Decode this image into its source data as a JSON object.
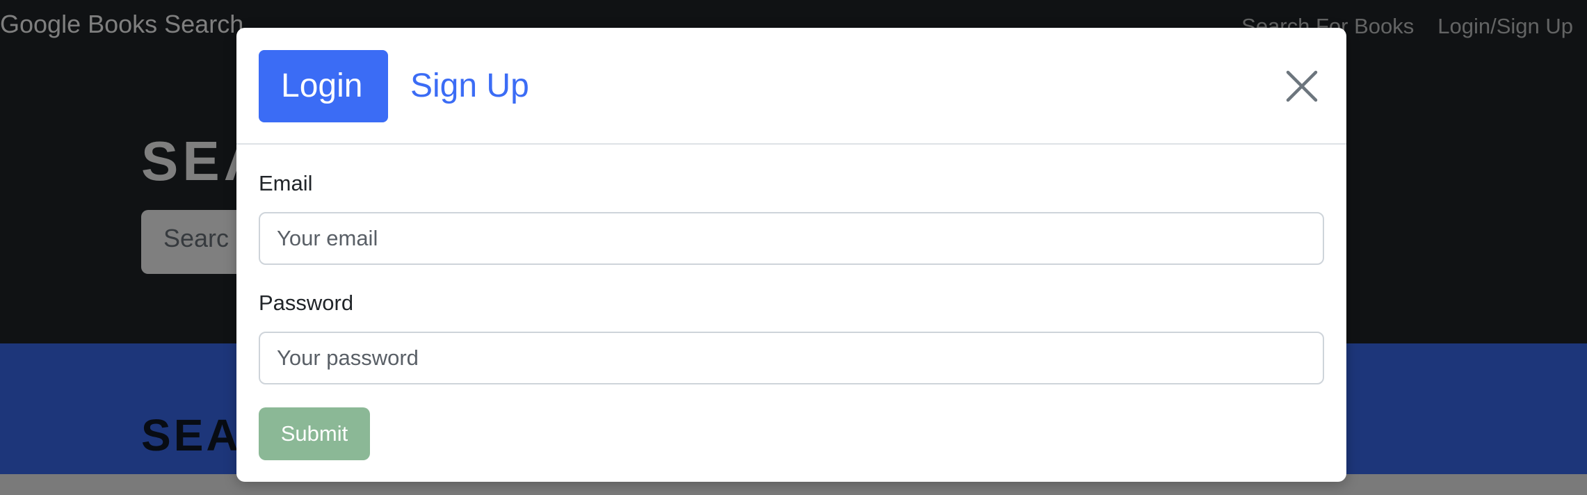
{
  "navbar": {
    "brand": "Google Books Search",
    "links": [
      "Search For Books",
      "Login/Sign Up"
    ]
  },
  "hero": {
    "title": "SEA",
    "search_placeholder": "Searc"
  },
  "results": {
    "title": "SEA"
  },
  "modal": {
    "tabs": [
      {
        "label": "Login",
        "active": true
      },
      {
        "label": "Sign Up",
        "active": false
      }
    ],
    "close_icon": "close-icon",
    "fields": {
      "email": {
        "label": "Email",
        "placeholder": "Your email"
      },
      "password": {
        "label": "Password",
        "placeholder": "Your password"
      }
    },
    "submit_label": "Submit"
  },
  "colors": {
    "primary": "#3b6cf5",
    "submit_disabled": "#8bb896",
    "dark_bg": "#212529"
  }
}
